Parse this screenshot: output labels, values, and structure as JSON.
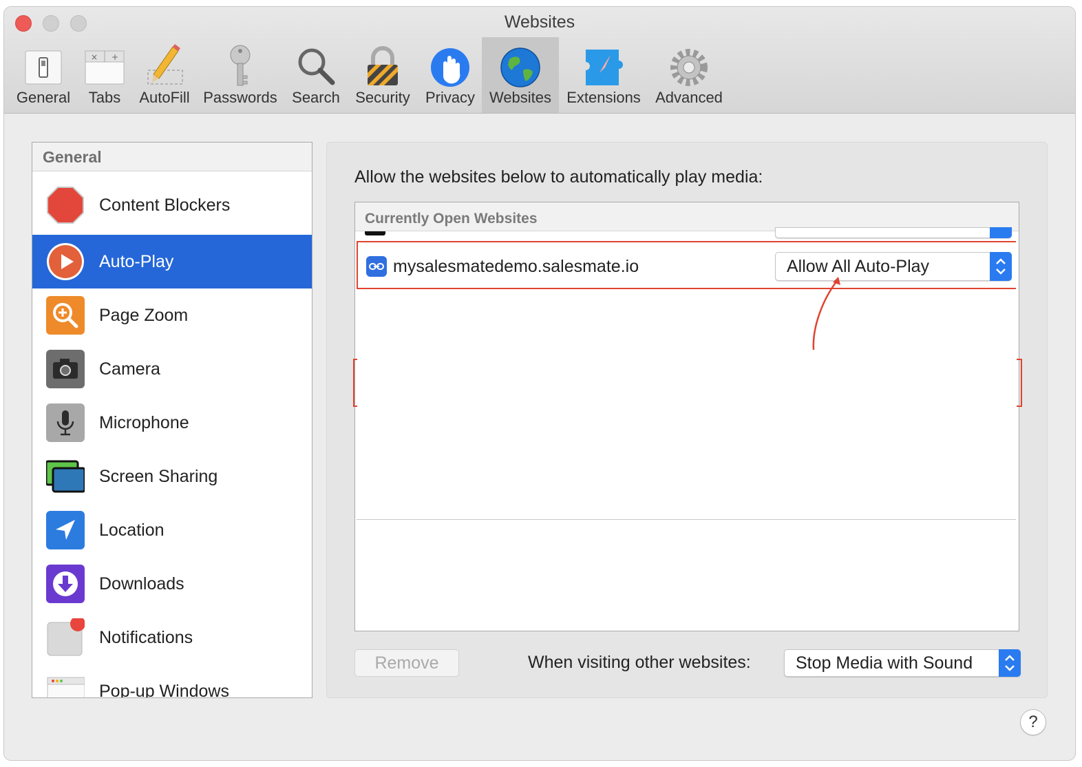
{
  "window": {
    "title": "Websites"
  },
  "toolbar": {
    "items": [
      {
        "label": "General",
        "icon": "general-switch-icon"
      },
      {
        "label": "Tabs",
        "icon": "tabs-icon"
      },
      {
        "label": "AutoFill",
        "icon": "pencil-icon"
      },
      {
        "label": "Passwords",
        "icon": "key-icon"
      },
      {
        "label": "Search",
        "icon": "magnifier-icon"
      },
      {
        "label": "Security",
        "icon": "padlock-icon"
      },
      {
        "label": "Privacy",
        "icon": "hand-icon"
      },
      {
        "label": "Websites",
        "icon": "globe-icon",
        "selected": true
      },
      {
        "label": "Extensions",
        "icon": "puzzle-compass-icon"
      },
      {
        "label": "Advanced",
        "icon": "gear-icon"
      }
    ]
  },
  "sidebar": {
    "header": "General",
    "items": [
      {
        "label": "Content Blockers",
        "icon": "stop-sign-icon"
      },
      {
        "label": "Auto-Play",
        "icon": "play-icon",
        "selected": true
      },
      {
        "label": "Page Zoom",
        "icon": "zoom-icon"
      },
      {
        "label": "Camera",
        "icon": "camera-icon"
      },
      {
        "label": "Microphone",
        "icon": "microphone-icon"
      },
      {
        "label": "Screen Sharing",
        "icon": "screen-sharing-icon"
      },
      {
        "label": "Location",
        "icon": "location-arrow-icon"
      },
      {
        "label": "Downloads",
        "icon": "download-icon"
      },
      {
        "label": "Notifications",
        "icon": "notifications-icon"
      },
      {
        "label": "Pop-up Windows",
        "icon": "popup-window-icon"
      }
    ]
  },
  "panel": {
    "description": "Allow the websites below to automatically play media:",
    "table_header": "Currently Open Websites",
    "rows": [
      {
        "site": "mysalesmatedemo.salesmate.io",
        "setting": "Allow All Auto-Play"
      }
    ],
    "remove_button": "Remove",
    "other_label": "When visiting other websites:",
    "other_setting": "Stop Media with Sound"
  },
  "help": {
    "label": "?"
  },
  "colors": {
    "selection": "#2567d8",
    "annotation": "#e0432f",
    "popup_accent": "#2a7bf0"
  }
}
